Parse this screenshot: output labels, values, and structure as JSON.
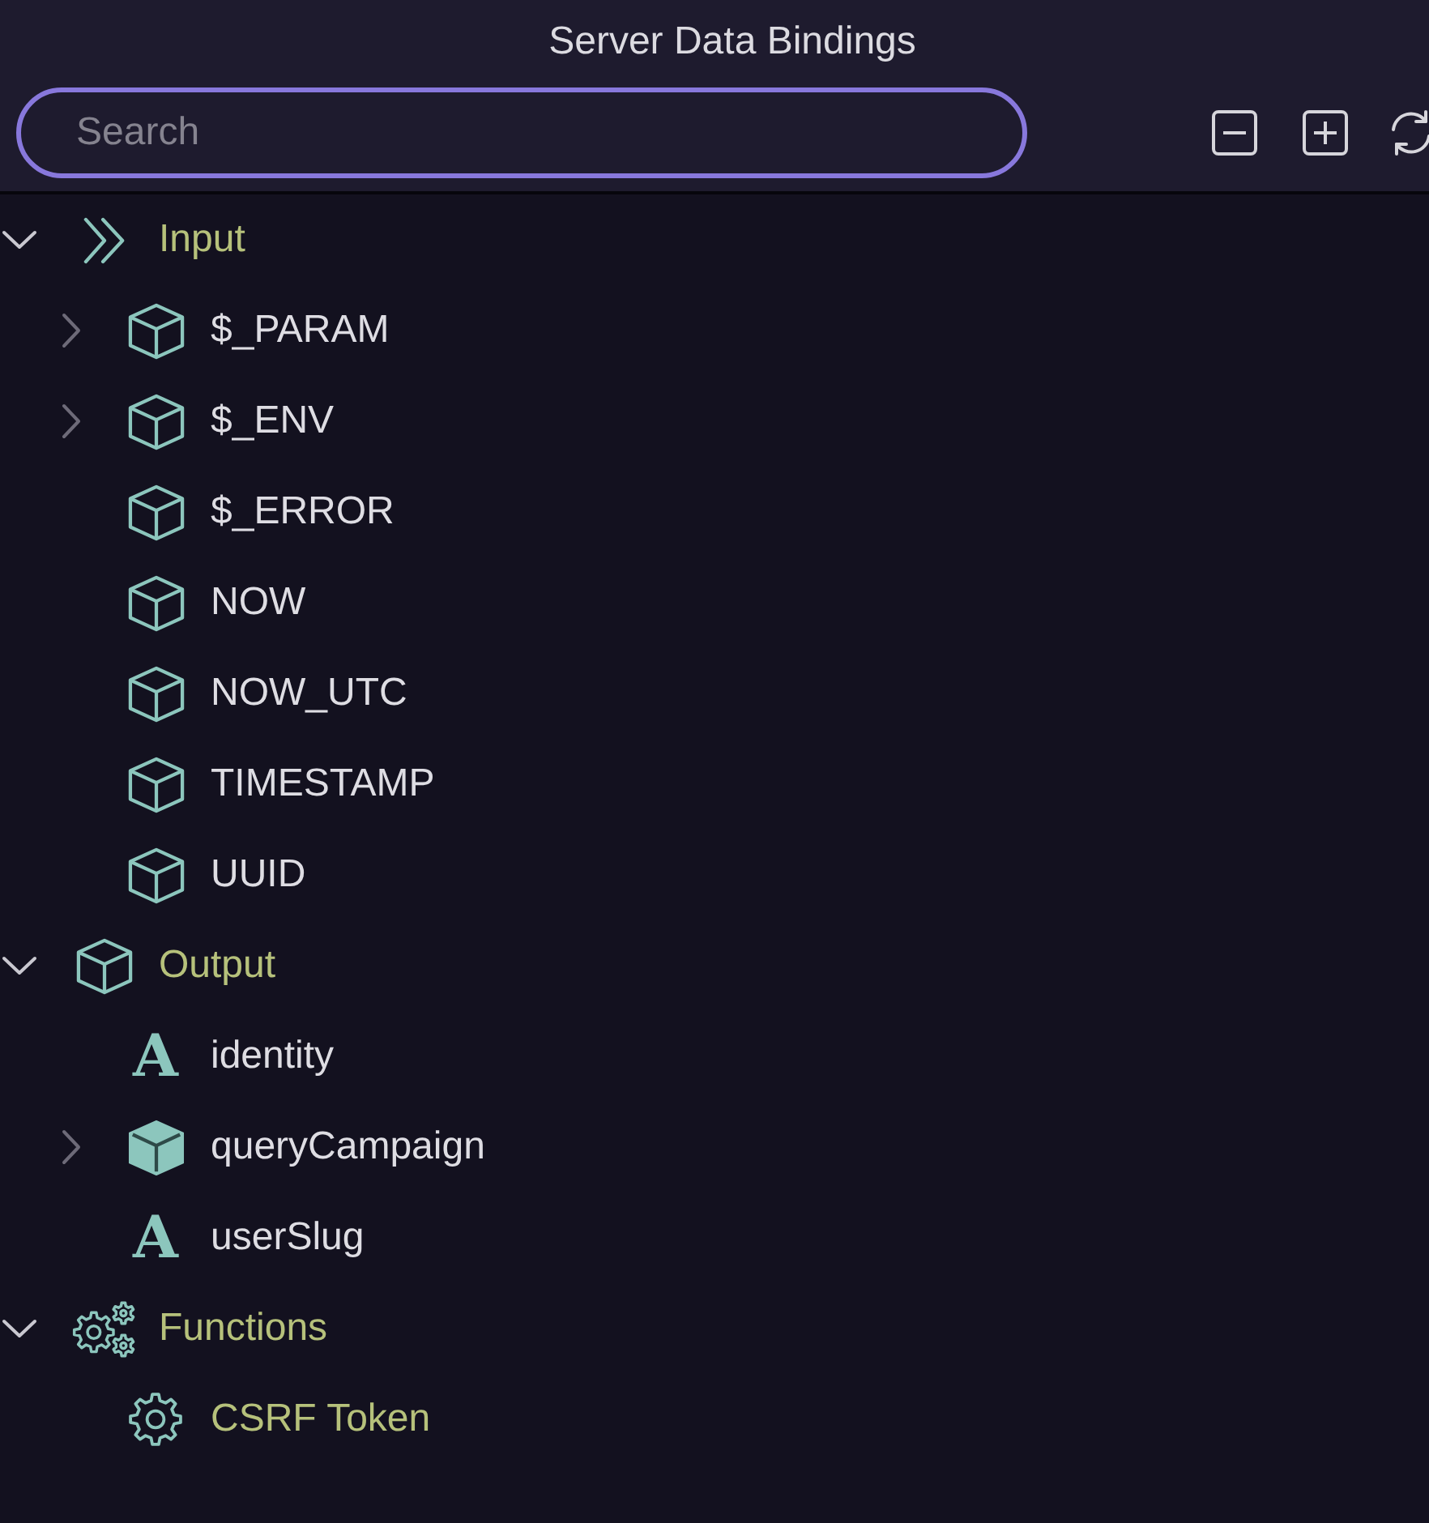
{
  "panel": {
    "title": "Server Data Bindings"
  },
  "search": {
    "placeholder": "Search"
  },
  "tree": [
    {
      "label": "Input",
      "kind": "inputs",
      "expanded": true,
      "children": [
        {
          "label": "$_PARAM",
          "kind": "variable",
          "expanded": false
        },
        {
          "label": "$_ENV",
          "kind": "variable",
          "expanded": false
        },
        {
          "label": "$_ERROR",
          "kind": "variable"
        },
        {
          "label": "NOW",
          "kind": "variable"
        },
        {
          "label": "NOW_UTC",
          "kind": "variable"
        },
        {
          "label": "TIMESTAMP",
          "kind": "variable"
        },
        {
          "label": "UUID",
          "kind": "variable"
        }
      ]
    },
    {
      "label": "Output",
      "kind": "outputs",
      "expanded": true,
      "children": [
        {
          "label": "identity",
          "kind": "string",
          "glyph": "A"
        },
        {
          "label": "queryCampaign",
          "kind": "object",
          "expanded": false
        },
        {
          "label": "userSlug",
          "kind": "string",
          "glyph": "A"
        }
      ]
    },
    {
      "label": "Functions",
      "kind": "functions",
      "expanded": true,
      "children": [
        {
          "label": "CSRF Token",
          "kind": "function"
        }
      ]
    }
  ]
}
